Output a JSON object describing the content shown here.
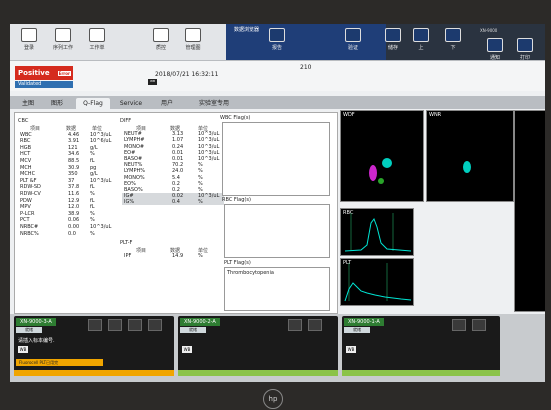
{
  "toolbar": {
    "buttons": [
      "登录",
      "序列工作",
      "工作单",
      "质控",
      "管理图",
      "报告"
    ],
    "title": "数据浏览器",
    "analyzer": "XN-9000",
    "right_buttons": [
      "验证",
      "储存",
      "上",
      "下",
      "通知",
      "打印"
    ]
  },
  "sample": {
    "flag": "Positive",
    "flag_small": "Error",
    "status": "Validated",
    "datetime": "2018/07/21 16:32:11",
    "number": "210",
    "badge": "WB"
  },
  "tabs": [
    "主图",
    "图形",
    "Q-Flag",
    "Service",
    "用户",
    "实验室专用"
  ],
  "cbc": {
    "title": "CBC",
    "headers": [
      "项目",
      "数据",
      "单位"
    ],
    "rows": [
      [
        "WBC",
        "4.46",
        "10^3/uL"
      ],
      [
        "RBC",
        "3.91",
        "10^6/uL"
      ],
      [
        "HGB",
        "121",
        "g/L"
      ],
      [
        "HCT",
        "34.6",
        "%"
      ],
      [
        "MCV",
        "88.5",
        "fL"
      ],
      [
        "MCH",
        "30.9",
        "pg"
      ],
      [
        "MCHC",
        "350",
        "g/L"
      ],
      [
        "PLT &F",
        "37",
        "10^3/uL"
      ],
      [
        "RDW-SD",
        "37.8",
        "fL"
      ],
      [
        "RDW-CV",
        "11.6",
        "%"
      ],
      [
        "PDW",
        "12.9",
        "fL"
      ],
      [
        "MPV",
        "12.0",
        "fL"
      ],
      [
        "P-LCR",
        "38.9",
        "%"
      ],
      [
        "PCT",
        "0.06",
        "%"
      ],
      [
        "NRBC#",
        "0.00",
        "10^3/uL"
      ],
      [
        "NRBC%",
        "0.0",
        "%"
      ]
    ]
  },
  "diff": {
    "title": "DIFF",
    "headers": [
      "项目",
      "数据",
      "单位"
    ],
    "rows": [
      [
        "NEUT#",
        "3.13",
        "10^3/uL"
      ],
      [
        "LYMPH#",
        "1.07",
        "10^3/uL"
      ],
      [
        "MONO#",
        "0.24",
        "10^3/uL"
      ],
      [
        "EO#",
        "0.01",
        "10^3/uL"
      ],
      [
        "BASO#",
        "0.01",
        "10^3/uL"
      ],
      [
        "NEUT%",
        "70.2",
        "%"
      ],
      [
        "LYMPH%",
        "24.0",
        "%"
      ],
      [
        "MONO%",
        "5.4",
        "%"
      ],
      [
        "EO%",
        "0.2",
        "%"
      ],
      [
        "BASO%",
        "0.2",
        "%"
      ],
      [
        "IG#",
        "0.02",
        "10^3/uL"
      ],
      [
        "IG%",
        "0.4",
        "%"
      ]
    ]
  },
  "pltf": {
    "title": "PLT-F",
    "headers": [
      "项目",
      "数据",
      "单位"
    ],
    "rows": [
      [
        "IPF",
        "14.9",
        "%"
      ]
    ]
  },
  "flags": {
    "wbc": "WBC Flag(s)",
    "rbc": "RBC Flag(s)",
    "plt": "PLT Flag(s)",
    "plt_msg": "Thrombocytopenia"
  },
  "plots": {
    "wdf": "WDF",
    "wnr": "WNR",
    "rbc": "RBC",
    "plt": "PLT"
  },
  "units": [
    {
      "name": "XN-9000-3-A",
      "sub": "就绪",
      "wb": "WB",
      "msg": "请插入标本编号.",
      "warn": "Fluorocell PLT已用完",
      "bar": "orange"
    },
    {
      "name": "XN-9000-2-A",
      "sub": "就绪",
      "wb": "WB",
      "msg": "",
      "warn": "",
      "bar": "green"
    },
    {
      "name": "XN-9000-1-A",
      "sub": "就绪",
      "wb": "WB",
      "msg": "",
      "warn": "",
      "bar": "green"
    }
  ],
  "brand": "hp"
}
